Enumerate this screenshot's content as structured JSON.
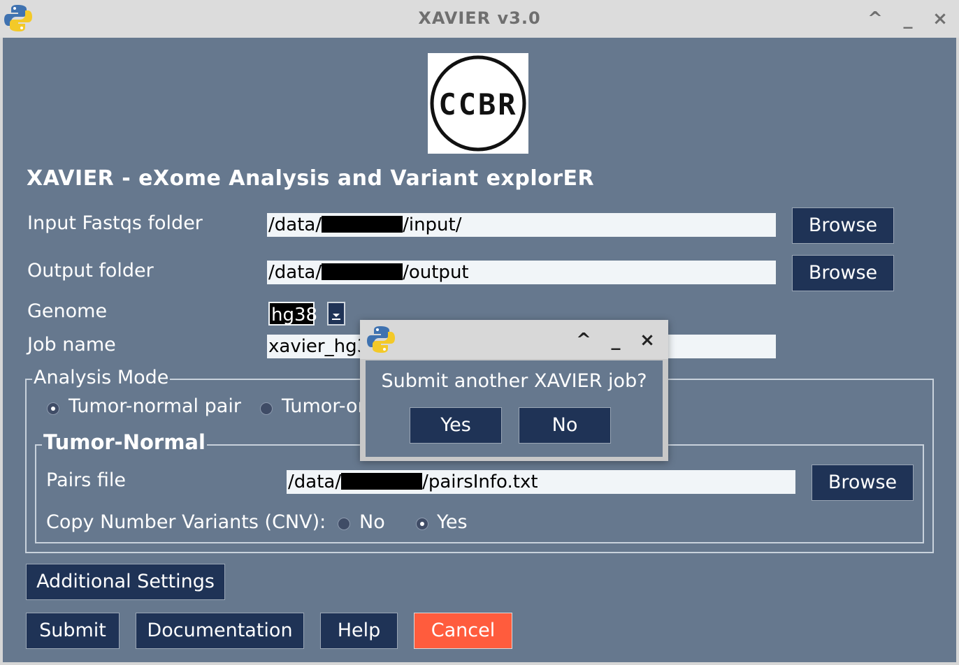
{
  "window": {
    "title": "XAVIER v3.0",
    "controls": [
      "^",
      "_",
      "×"
    ]
  },
  "logo": {
    "text": "CCBR"
  },
  "heading": "XAVIER - eXome Analysis and Variant explorER",
  "form": {
    "input_label": "Input Fastqs folder",
    "input_prefix": "/data/",
    "input_suffix": "/input/",
    "output_label": "Output folder",
    "output_prefix": "/data/",
    "output_suffix": "/output",
    "genome_label": "Genome",
    "genome_value": "hg38",
    "jobname_label": "Job name",
    "jobname_value": "xavier_hg3",
    "browse_label": "Browse"
  },
  "analysis_mode": {
    "title": "Analysis Mode",
    "option1": "Tumor-normal pair",
    "option2": "Tumor-or"
  },
  "tumor_normal": {
    "title": "Tumor-Normal",
    "pairs_label": "Pairs file",
    "pairs_prefix": "/data/",
    "pairs_suffix": "/pairsInfo.txt",
    "browse_label": "Browse",
    "cnv_label": "Copy Number Variants (CNV):",
    "cnv_no": "No",
    "cnv_yes": "Yes"
  },
  "buttons": {
    "additional": "Additional Settings",
    "submit": "Submit",
    "documentation": "Documentation",
    "help": "Help",
    "cancel": "Cancel"
  },
  "dialog": {
    "message": "Submit another XAVIER job?",
    "yes": "Yes",
    "no": "No",
    "controls": [
      "^",
      "_",
      "×"
    ]
  },
  "colors": {
    "panel_bg": "#66788e",
    "button_bg": "#1f3356",
    "cancel_bg": "#ff5c3d",
    "field_bg": "#f1f5f8",
    "titlebar_bg": "#dcdcdc"
  },
  "icons": {
    "app": "python-logo-icon",
    "dropdown": "chevron-down-icon",
    "radio": "radio-button"
  }
}
